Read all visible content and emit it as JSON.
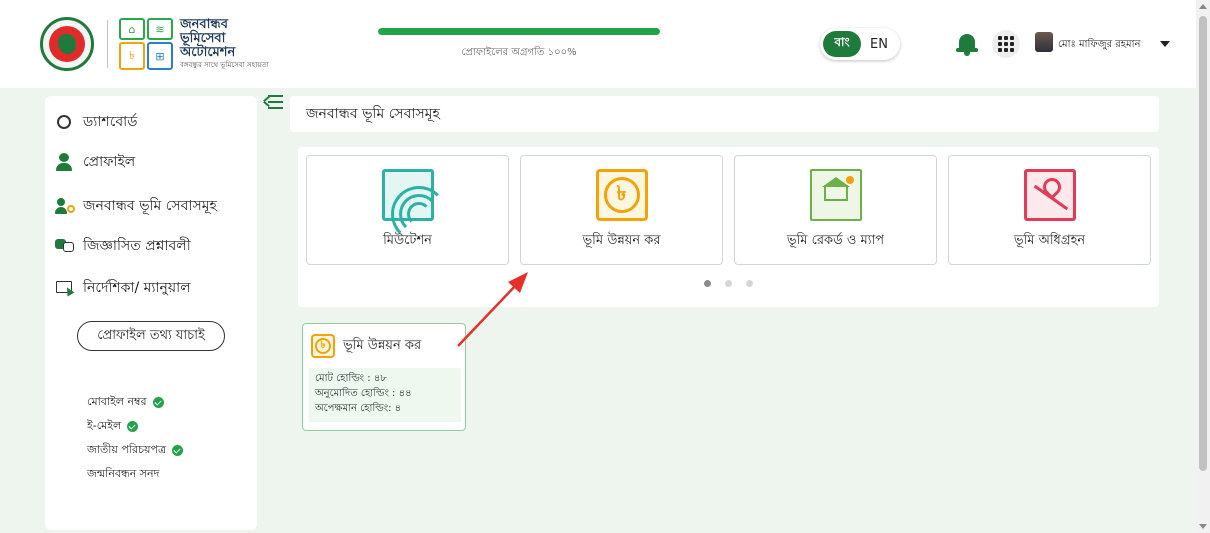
{
  "header": {
    "logo_title_line1": "জনবান্ধব",
    "logo_title_line2": "ভূমিসেবা",
    "logo_title_line3": "অটোমেশন",
    "logo_tagline": "বঙ্গবন্ধুর সাথে ভূমিসেবা সহায়তা",
    "progress_label": "প্রোফাইলের অগ্রগতি ১০০%",
    "progress_fraction": 1.0,
    "lang_bn": "বাং",
    "lang_en": "EN",
    "user_name": "মোঃ মাফিজুর রহমান"
  },
  "sidebar": {
    "items": [
      {
        "label": "ড্যাশবোর্ড",
        "icon": "dashboard-gauge-icon"
      },
      {
        "label": "প্রোফাইল",
        "icon": "person-icon"
      },
      {
        "label": "জনবান্ধব ভূমি সেবাসমূহ",
        "icon": "user-gear-icon"
      },
      {
        "label": "জিজ্ঞাসিত প্রশ্নাবলী",
        "icon": "faq-chat-icon"
      },
      {
        "label": "নির্দেশিকা/ ম্যানুয়াল",
        "icon": "manual-pointer-icon"
      }
    ],
    "verify_button": "প্রোফাইল তথ্য যাচাই",
    "verify_items": [
      {
        "label": "মোবাইল নম্বর",
        "verified": true
      },
      {
        "label": "ই-মেইল",
        "verified": true
      },
      {
        "label": "জাতীয় পরিচয়পত্র",
        "verified": true
      },
      {
        "label": "জন্মনিবন্ধন সনদ",
        "verified": false
      }
    ]
  },
  "main": {
    "page_title": "জনবান্ধব ভূমি সেবাসমূহ",
    "service_cards": [
      {
        "label": "মিউটেশন",
        "icon": "mutation-icon",
        "color": "#2ab3a4"
      },
      {
        "label": "ভূমি উন্নয়ন কর",
        "icon": "taka-coin-icon",
        "color": "#f4a20a"
      },
      {
        "label": "ভূমি রেকর্ড ও ম্যাপ",
        "icon": "land-record-map-icon",
        "color": "#6bb04a"
      },
      {
        "label": "ভূমি অধিগ্রহন",
        "icon": "map-pin-icon",
        "color": "#e33a5a"
      }
    ],
    "carousel_page_count": 3,
    "carousel_active_index": 0,
    "info_card": {
      "title": "ভূমি উন্নয়ন কর",
      "lines": [
        "মোট হোল্ডিং : ৪৮",
        "অনুমোদিত হোল্ডিং : ৪৪",
        "অপেক্ষমান হোল্ডিং: ৪"
      ]
    }
  },
  "colors": {
    "brand_green": "#1e7b3c",
    "progress_green": "#22a34a",
    "annotation_arrow": "#e8302a"
  }
}
